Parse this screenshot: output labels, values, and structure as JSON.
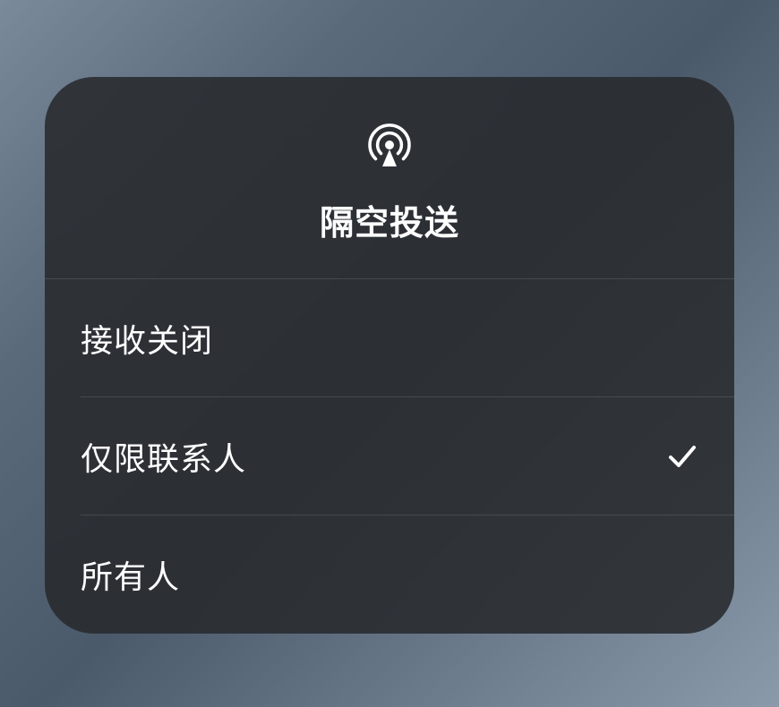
{
  "modal": {
    "title": "隔空投送",
    "icon": "airdrop-icon",
    "options": [
      {
        "label": "接收关闭",
        "selected": false
      },
      {
        "label": "仅限联系人",
        "selected": true
      },
      {
        "label": "所有人",
        "selected": false
      }
    ]
  }
}
